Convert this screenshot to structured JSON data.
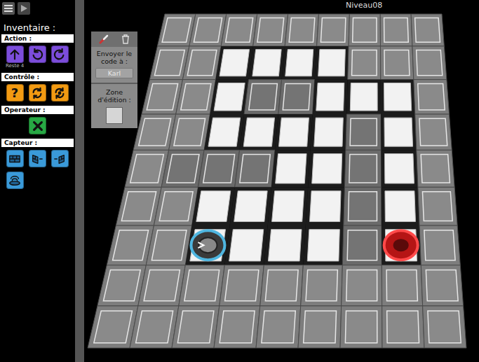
{
  "top_bar": {
    "level": "Niveau08"
  },
  "inventory": {
    "title": "Inventaire :",
    "sections": [
      {
        "title": "Action :",
        "color": "#7c4ddb",
        "items": [
          {
            "kind": "forward",
            "note": "Reste 4"
          },
          {
            "kind": "turn-left"
          },
          {
            "kind": "turn-right"
          }
        ]
      },
      {
        "title": "Contrôle :",
        "color": "#f29a12",
        "items": [
          {
            "kind": "if",
            "label": "?"
          },
          {
            "kind": "loop"
          },
          {
            "kind": "loop-until"
          }
        ]
      },
      {
        "title": "Operateur :",
        "color": "#27a844",
        "items": [
          {
            "kind": "not"
          }
        ]
      },
      {
        "title": "Capteur :",
        "color": "#3a9ad9",
        "items": [
          {
            "kind": "wall-front"
          },
          {
            "kind": "wall-left"
          },
          {
            "kind": "wall-right"
          },
          {
            "kind": "floor"
          }
        ]
      }
    ]
  },
  "editor": {
    "send_label": "Envoyer le code à :",
    "recipient": "Karl",
    "edit_label": "Zone d'édition :"
  },
  "board": {
    "rows": [
      "bbbbbbbbb",
      "bbffffbbb",
      "bbfwwfffb",
      "bbffffwfb",
      "bwwwffwfb",
      "bbffffwfb",
      "bbffffwfb",
      "bbbbbbbbb",
      "bbbbbbbbb"
    ],
    "robot": {
      "row": 6,
      "col": 2
    },
    "goal": {
      "row": 6,
      "col": 7
    }
  }
}
